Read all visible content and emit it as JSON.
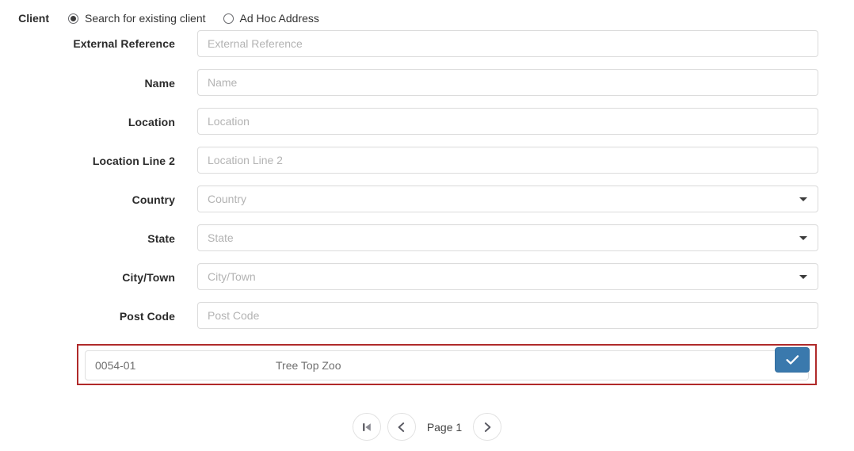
{
  "client": {
    "label": "Client",
    "options": [
      {
        "label": "Search for existing client",
        "selected": true
      },
      {
        "label": "Ad Hoc Address",
        "selected": false
      }
    ]
  },
  "form": {
    "fields": [
      {
        "label": "External Reference",
        "placeholder": "External Reference",
        "value": "",
        "type": "text"
      },
      {
        "label": "Name",
        "placeholder": "Name",
        "value": "",
        "type": "text"
      },
      {
        "label": "Location",
        "placeholder": "Location",
        "value": "",
        "type": "text"
      },
      {
        "label": "Location Line 2",
        "placeholder": "Location Line 2",
        "value": "",
        "type": "text"
      },
      {
        "label": "Country",
        "placeholder": "Country",
        "value": "",
        "type": "select"
      },
      {
        "label": "State",
        "placeholder": "State",
        "value": "",
        "type": "select"
      },
      {
        "label": "City/Town",
        "placeholder": "City/Town",
        "value": "",
        "type": "select"
      },
      {
        "label": "Post Code",
        "placeholder": "Post Code",
        "value": "",
        "type": "text"
      }
    ]
  },
  "results": {
    "highlight_color": "#b02a2a",
    "rows": [
      {
        "code": "0054-01",
        "name": "Tree Top Zoo",
        "action_icon": "check-icon"
      }
    ]
  },
  "pagination": {
    "first_icon": "skip-to-first-icon",
    "prev_icon": "chevron-left-icon",
    "page_label": "Page 1",
    "next_icon": "chevron-right-icon"
  },
  "colors": {
    "primary": "#3a79ad",
    "danger": "#b02a2a",
    "placeholder": "#b3b3b3"
  }
}
